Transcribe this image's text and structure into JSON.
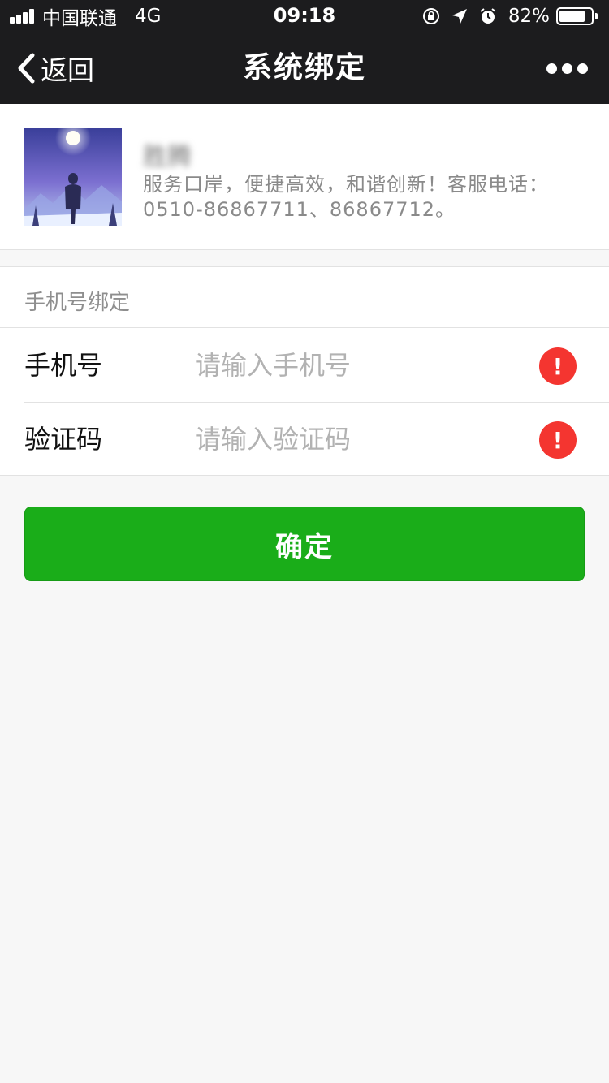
{
  "status_bar": {
    "carrier": "中国联通",
    "network": "4G",
    "time": "09:18",
    "battery_text": "82%",
    "battery_level": 0.82,
    "icons": [
      "signal-icon",
      "rotation-lock-icon",
      "location-icon",
      "alarm-icon",
      "battery-icon"
    ]
  },
  "nav": {
    "back_label": "返回",
    "title": "系统绑定",
    "more_icon": "more-dots-icon"
  },
  "profile": {
    "name": "胜腾",
    "description": "服务口岸，便捷高效，和谐创新！客服电话：0510-86867711、86867712。"
  },
  "form": {
    "section_title": "手机号绑定",
    "phone": {
      "label": "手机号",
      "value": "",
      "placeholder": "请输入手机号"
    },
    "code": {
      "label": "验证码",
      "value": "",
      "placeholder": "请输入验证码"
    },
    "warn_glyph": "!"
  },
  "confirm_label": "确定",
  "colors": {
    "bar_bg": "#1c1c1e",
    "primary_green": "#1aad19",
    "error_red": "#f43530",
    "page_bg": "#f7f7f7"
  }
}
